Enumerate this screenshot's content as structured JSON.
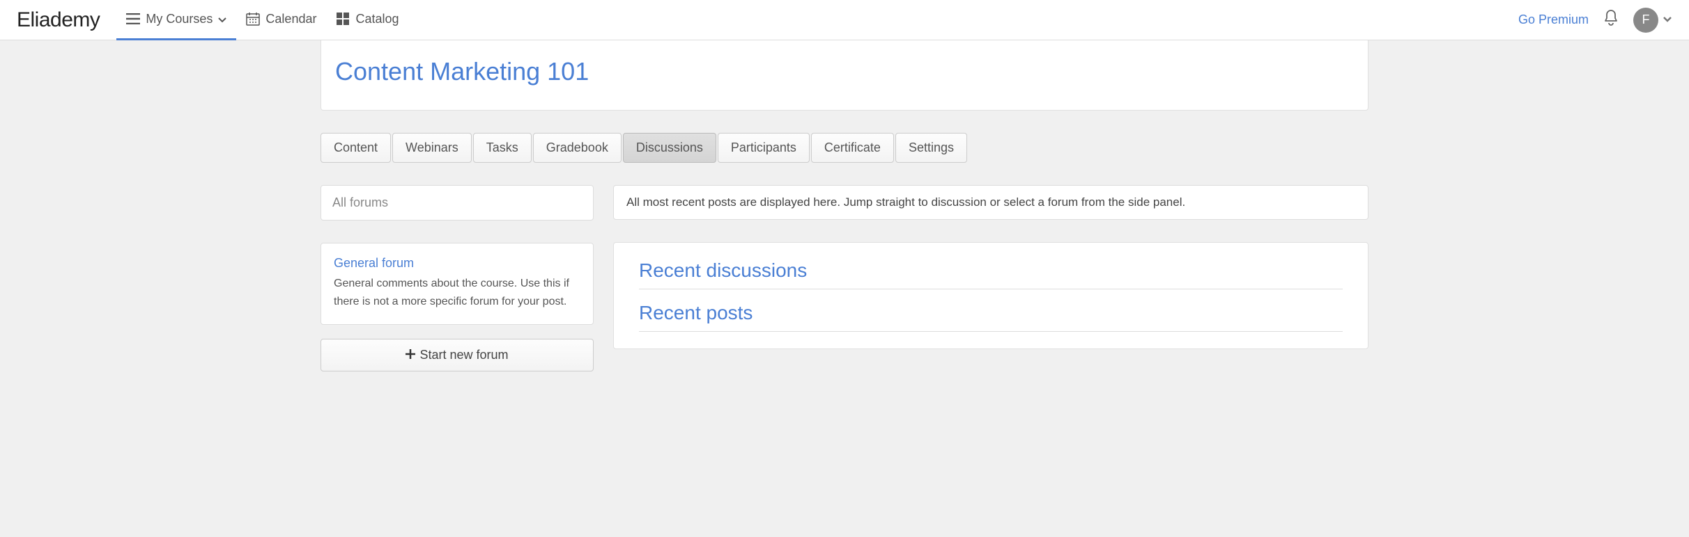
{
  "brand": "Eliademy",
  "nav": {
    "my_courses": "My Courses",
    "calendar": "Calendar",
    "catalog": "Catalog",
    "go_premium": "Go Premium"
  },
  "user": {
    "initial": "F"
  },
  "course": {
    "title": "Content Marketing 101"
  },
  "tabs": {
    "content": "Content",
    "webinars": "Webinars",
    "tasks": "Tasks",
    "gradebook": "Gradebook",
    "discussions": "Discussions",
    "participants": "Participants",
    "certificate": "Certificate",
    "settings": "Settings"
  },
  "sidebar": {
    "all_forums": "All forums",
    "forum": {
      "title": "General forum",
      "description": "General comments about the course. Use this if there is not a more specific forum for your post."
    },
    "start_button": "Start new forum"
  },
  "main": {
    "info": "All most recent posts are displayed here. Jump straight to discussion or select a forum from the side panel.",
    "recent_discussions": "Recent discussions",
    "recent_posts": "Recent posts"
  }
}
